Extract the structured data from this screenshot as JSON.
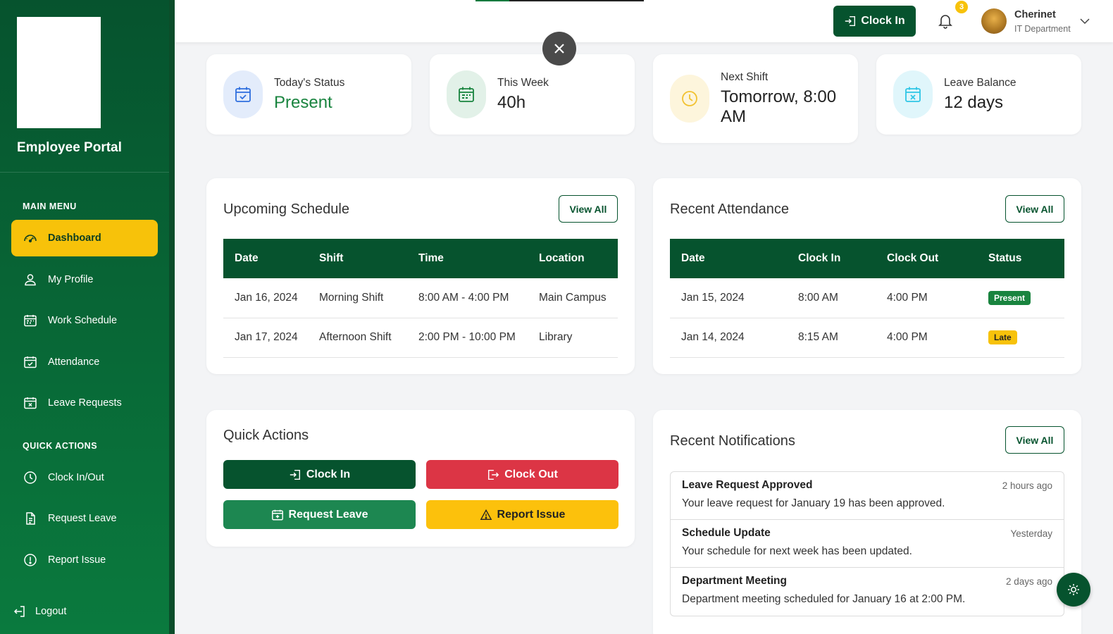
{
  "sidebar": {
    "title": "Employee Portal",
    "main_menu_label": "MAIN MENU",
    "quick_actions_label": "QUICK ACTIONS",
    "main_items": [
      {
        "label": "Dashboard",
        "icon": "speedometer-icon",
        "active": true
      },
      {
        "label": "My Profile",
        "icon": "person-icon"
      },
      {
        "label": "Work Schedule",
        "icon": "calendar-week-icon"
      },
      {
        "label": "Attendance",
        "icon": "calendar-check-icon"
      },
      {
        "label": "Leave Requests",
        "icon": "calendar-x-icon"
      }
    ],
    "quick_items": [
      {
        "label": "Clock In/Out",
        "icon": "clock-icon"
      },
      {
        "label": "Request Leave",
        "icon": "file-text-icon"
      },
      {
        "label": "Report Issue",
        "icon": "exclamation-circle-icon"
      }
    ],
    "logout_label": "Logout"
  },
  "topbar": {
    "clock_in_label": "Clock In",
    "notification_count": "3",
    "user_name": "Cherinet",
    "user_department": "IT Department"
  },
  "stats": [
    {
      "label": "Today's Status",
      "value": "Present",
      "icon": "calendar-check-icon",
      "color": "#19843f"
    },
    {
      "label": "This Week",
      "value": "40h",
      "icon": "calendar-week-icon",
      "color": "#222222"
    },
    {
      "label": "Next Shift",
      "value": "Tomorrow, 8:00 AM",
      "icon": "clock-icon",
      "color": "#222222"
    },
    {
      "label": "Leave Balance",
      "value": "12 days",
      "icon": "calendar-x-icon",
      "color": "#222222"
    }
  ],
  "schedule": {
    "title": "Upcoming Schedule",
    "view_all": "View All",
    "columns": [
      "Date",
      "Shift",
      "Time",
      "Location"
    ],
    "rows": [
      [
        "Jan 16, 2024",
        "Morning Shift",
        "8:00 AM - 4:00 PM",
        "Main Campus"
      ],
      [
        "Jan 17, 2024",
        "Afternoon Shift",
        "2:00 PM - 10:00 PM",
        "Library"
      ]
    ]
  },
  "attendance": {
    "title": "Recent Attendance",
    "view_all": "View All",
    "columns": [
      "Date",
      "Clock In",
      "Clock Out",
      "Status"
    ],
    "rows": [
      {
        "date": "Jan 15, 2024",
        "in": "8:00 AM",
        "out": "4:00 PM",
        "status": "Present"
      },
      {
        "date": "Jan 14, 2024",
        "in": "8:15 AM",
        "out": "4:00 PM",
        "status": "Late"
      }
    ]
  },
  "quick_actions": {
    "title": "Quick Actions",
    "clock_in": "Clock In",
    "clock_out": "Clock Out",
    "request_leave": "Request Leave",
    "report_issue": "Report Issue"
  },
  "notifications": {
    "title": "Recent Notifications",
    "view_all": "View All",
    "items": [
      {
        "title": "Leave Request Approved",
        "time": "2 hours ago",
        "text": "Your leave request for January 19 has been approved."
      },
      {
        "title": "Schedule Update",
        "time": "Yesterday",
        "text": "Your schedule for next week has been updated."
      },
      {
        "title": "Department Meeting",
        "time": "2 days ago",
        "text": "Department meeting scheduled for January 16 at 2:00 PM."
      }
    ]
  },
  "colors": {
    "primary_green": "#06532e",
    "accent_yellow": "#f7c20a",
    "danger_red": "#dc3545",
    "success_green": "#19843f"
  },
  "page_progress": 0.2
}
